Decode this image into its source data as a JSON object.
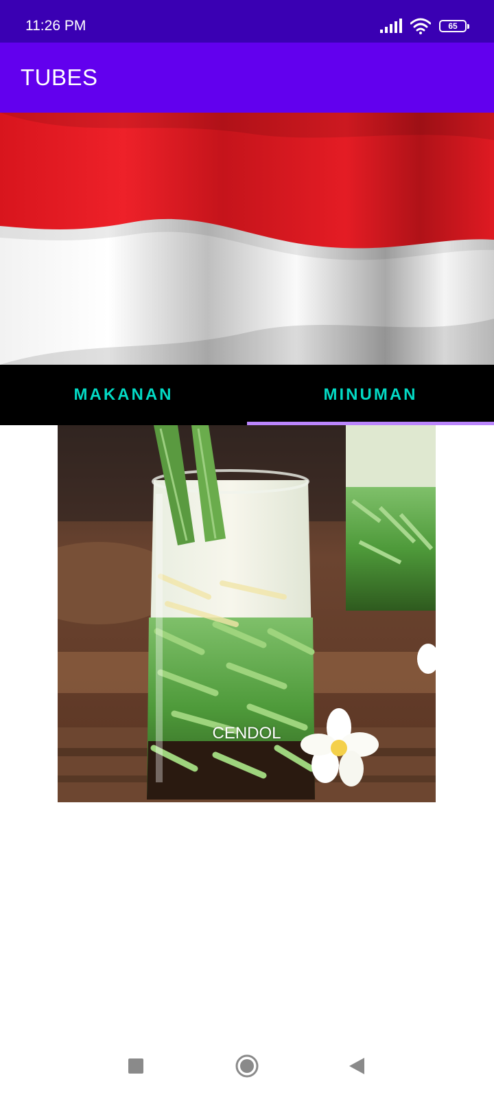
{
  "status_bar": {
    "time": "11:26 PM",
    "battery_level": "65",
    "icons": [
      "signal-icon",
      "wifi-icon",
      "battery-icon"
    ]
  },
  "app_bar": {
    "title": "TUBES"
  },
  "banner": {
    "image": "indonesian-flag",
    "colors": {
      "red": "#e31b23",
      "white": "#f4f4f4"
    }
  },
  "tabs": [
    {
      "label": "MAKANAN",
      "selected": false
    },
    {
      "label": "MINUMAN",
      "selected": true
    }
  ],
  "items": [
    {
      "name": "CENDOL",
      "image": "cendol-drink"
    }
  ],
  "nav_bar": {
    "buttons": [
      "recents-icon",
      "home-icon",
      "back-icon"
    ]
  },
  "colors": {
    "status_bar": "#3a00b3",
    "app_bar": "#6200ee",
    "tab_text": "#03dac5",
    "tab_indicator": "#bb86fc",
    "tab_background": "#000000"
  }
}
